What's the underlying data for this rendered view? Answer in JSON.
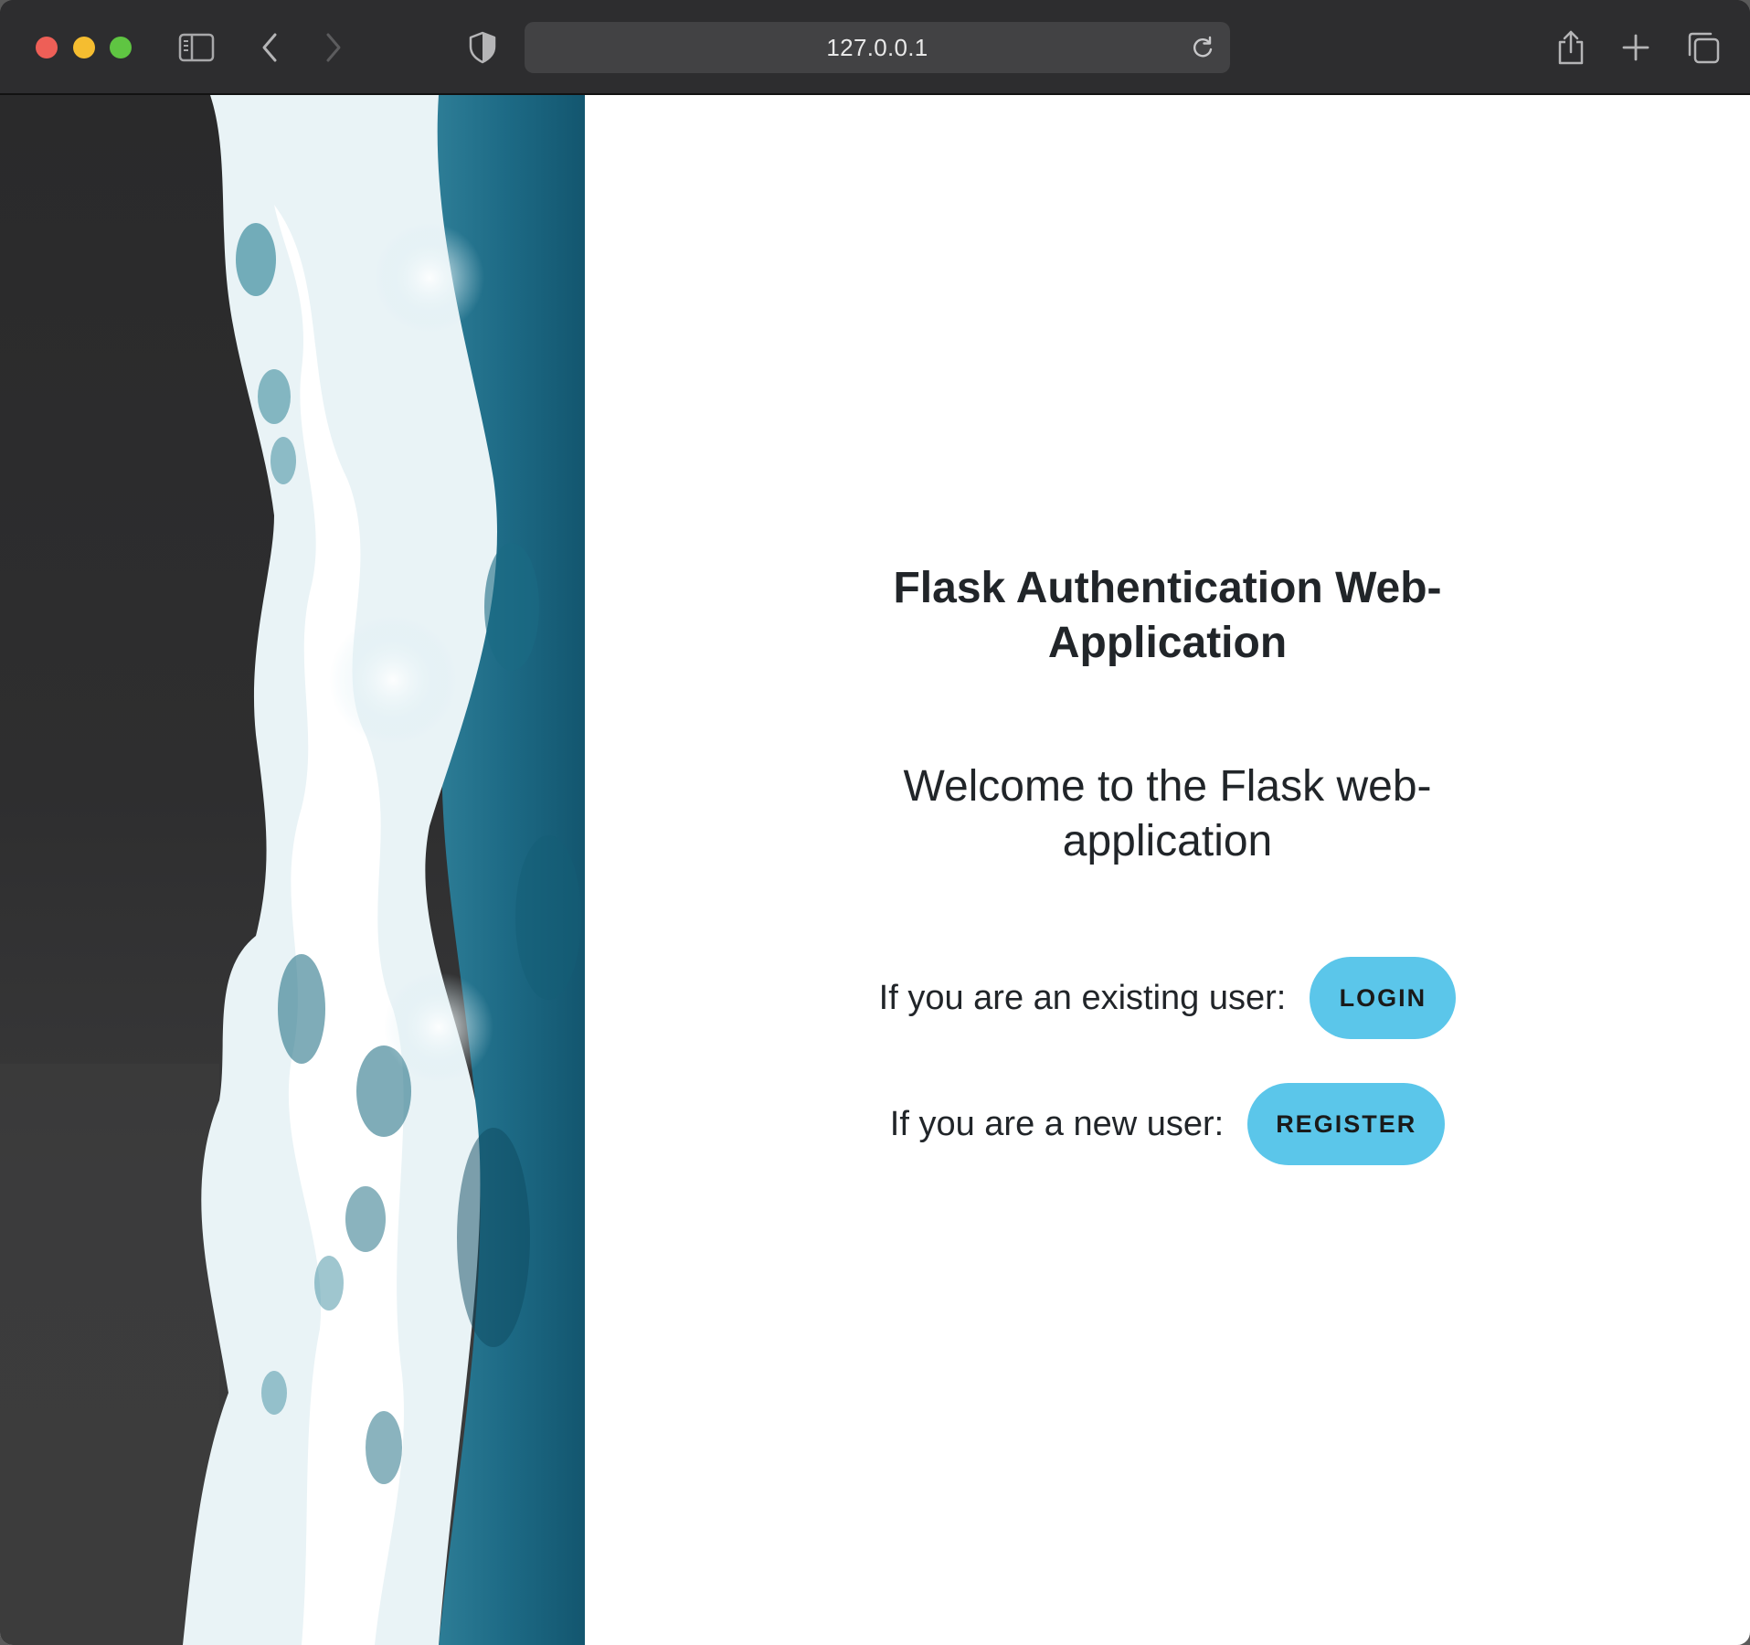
{
  "browser": {
    "url": "127.0.0.1",
    "icons": {
      "close": "close-window-dot",
      "minimize": "minimize-window-dot",
      "maximize": "maximize-window-dot",
      "sidebar": "sidebar-icon",
      "back": "chevron-left-icon",
      "forward": "chevron-right-icon",
      "privacy": "shield-icon",
      "reload": "reload-icon",
      "share": "share-icon",
      "new_tab": "plus-icon",
      "tabs": "tab-overview-icon"
    },
    "colors": {
      "toolbar": "#2d2d2f",
      "address_bar": "#424244",
      "close": "#ee5f57",
      "minimize": "#f5bd30",
      "maximize": "#5fc542"
    }
  },
  "page": {
    "title_line1": "Flask Authentication Web-",
    "title_line2": "Application",
    "welcome_line1": "Welcome to the Flask web-",
    "welcome_line2": "application",
    "login_prompt": "If you are an existing user:",
    "login_button": "LOGIN",
    "register_prompt": "If you are a new user:",
    "register_button": "REGISTER",
    "image": "aerial-ocean-waves-on-black-sand-beach",
    "colors": {
      "button": "#5bc6ea",
      "text": "#212529",
      "background": "#ffffff"
    }
  }
}
